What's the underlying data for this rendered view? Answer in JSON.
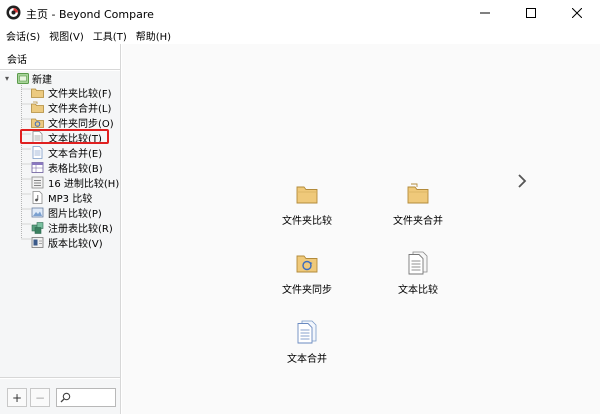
{
  "window": {
    "title": "主页 - Beyond Compare"
  },
  "menu": [
    "会话(S)",
    "视图(V)",
    "工具(T)",
    "帮助(H)"
  ],
  "sidebar": {
    "header": "会话",
    "root_label": "新建",
    "items": [
      {
        "label": "文件夹比较(F)",
        "icon": "folder-compare-icon"
      },
      {
        "label": "文件夹合并(L)",
        "icon": "folder-merge-icon"
      },
      {
        "label": "文件夹同步(O)",
        "icon": "folder-sync-icon"
      },
      {
        "label": "文本比较(T)",
        "icon": "text-compare-icon",
        "highlighted": true
      },
      {
        "label": "文本合并(E)",
        "icon": "text-merge-icon"
      },
      {
        "label": "表格比较(B)",
        "icon": "table-compare-icon"
      },
      {
        "label": "16 进制比较(H)",
        "icon": "hex-compare-icon"
      },
      {
        "label": "MP3 比较",
        "icon": "mp3-compare-icon"
      },
      {
        "label": "图片比较(P)",
        "icon": "picture-compare-icon"
      },
      {
        "label": "注册表比较(R)",
        "icon": "registry-compare-icon"
      },
      {
        "label": "版本比较(V)",
        "icon": "version-compare-icon"
      }
    ],
    "add_label": "+",
    "remove_label": "−"
  },
  "main": {
    "tiles": [
      {
        "label": "文件夹比较",
        "icon": "folder-compare-icon"
      },
      {
        "label": "文件夹合并",
        "icon": "folder-merge-icon"
      },
      {
        "label": "文件夹同步",
        "icon": "folder-sync-icon"
      },
      {
        "label": "文本比较",
        "icon": "text-compare-icon"
      },
      {
        "label": "文本合并",
        "icon": "text-merge-icon"
      }
    ]
  },
  "colors": {
    "highlight_border": "#e02020",
    "folder": "#e8c47a",
    "accent": "#3a7bd5"
  }
}
